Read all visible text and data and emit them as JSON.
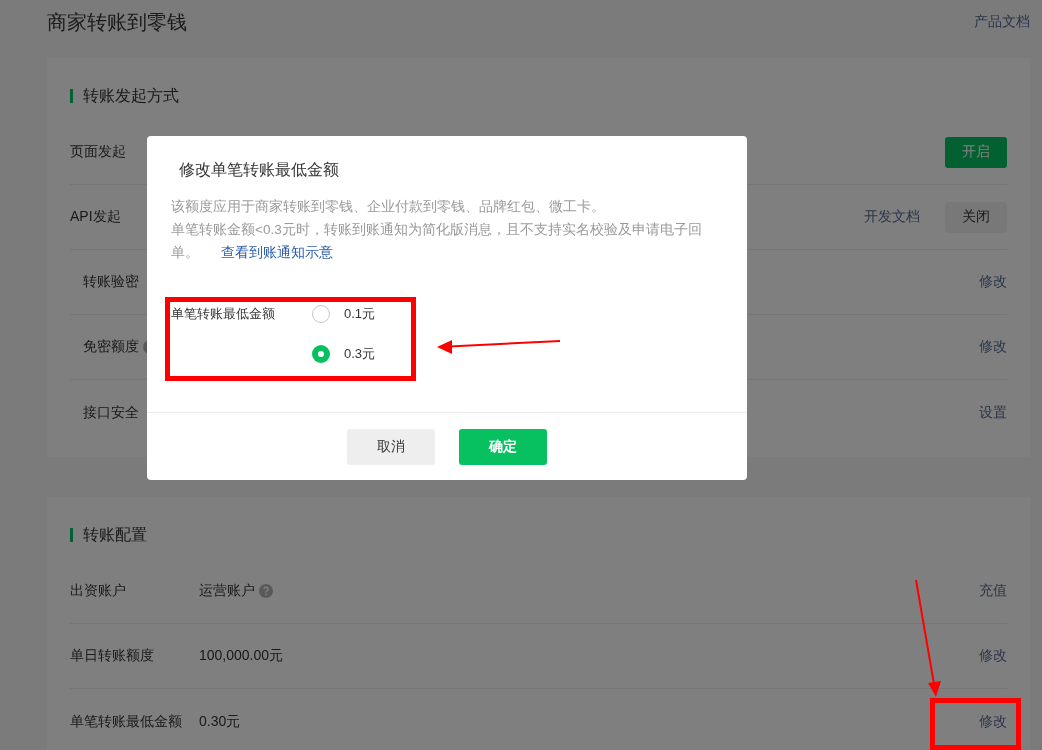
{
  "page": {
    "title": "商家转账到零钱",
    "doc_link": "产品文档"
  },
  "sections": [
    {
      "title": "转账发起方式",
      "rows": [
        {
          "label": "页面发起",
          "actions": [
            {
              "kind": "primary",
              "label": "开启"
            }
          ]
        },
        {
          "label": "API发起",
          "actions": [
            {
              "kind": "link",
              "label": "开发文档"
            },
            {
              "kind": "default",
              "label": "关闭"
            }
          ],
          "children": [
            {
              "label": "转账验密",
              "actions": [
                {
                  "kind": "link",
                  "label": "修改"
                }
              ]
            },
            {
              "label": "免密额度",
              "help": true,
              "actions": [
                {
                  "kind": "link",
                  "label": "修改"
                }
              ]
            },
            {
              "label": "接口安全",
              "actions": [
                {
                  "kind": "link",
                  "label": "设置"
                }
              ]
            }
          ]
        }
      ]
    },
    {
      "title": "转账配置",
      "rows": [
        {
          "label": "出资账户",
          "value": "运营账户",
          "help": true,
          "actions": [
            {
              "kind": "link",
              "label": "充值"
            }
          ]
        },
        {
          "label": "单日转账额度",
          "value": "100,000.00元",
          "actions": [
            {
              "kind": "link",
              "label": "修改"
            }
          ]
        },
        {
          "label": "单笔转账最低金额",
          "value": "0.30元",
          "actions": [
            {
              "kind": "link",
              "label": "修改"
            }
          ]
        }
      ]
    }
  ],
  "dialog": {
    "title": "修改单笔转账最低金额",
    "description": [
      "该额度应用于商家转账到零钱、企业付款到零钱、品牌红包、微工卡。",
      "单笔转账金额<0.3元时，转账到账通知为简化版消息，且不支持实名校验及申请电子回单。"
    ],
    "link": "查看到账通知示意",
    "field_label": "单笔转账最低金额",
    "options": [
      {
        "label": "0.1元",
        "selected": false
      },
      {
        "label": "0.3元",
        "selected": true
      }
    ],
    "buttons": [
      {
        "kind": "default",
        "label": "取消"
      },
      {
        "kind": "primary",
        "label": "确定"
      }
    ]
  }
}
